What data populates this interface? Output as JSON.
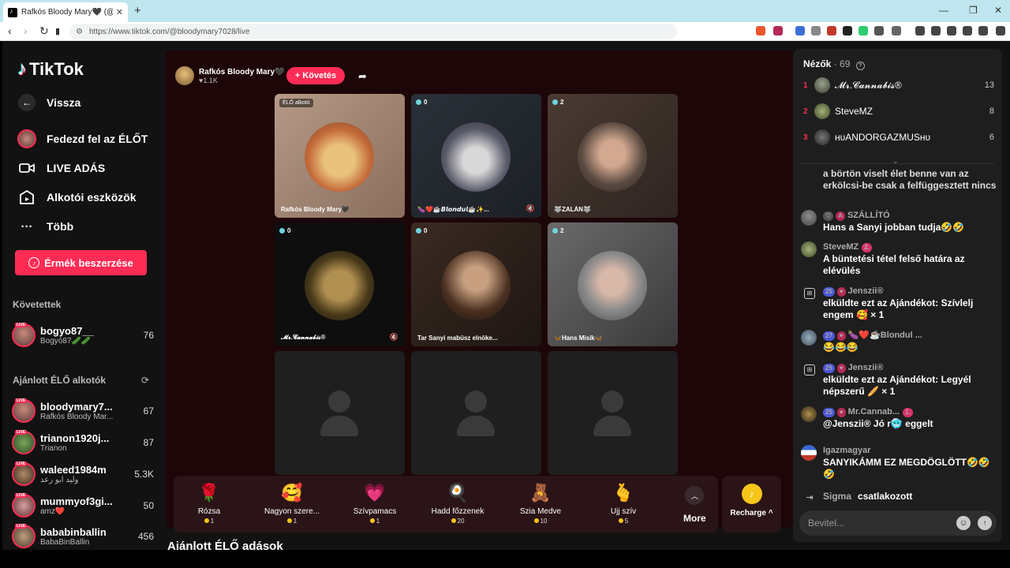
{
  "browser": {
    "tab_title": "Rafkós Bloody Mary🖤 (@bl",
    "url": "https://www.tiktok.com/@bloodymary7028/live"
  },
  "sidebar": {
    "logo": "TikTok",
    "nav": [
      {
        "label": "Vissza",
        "icon": "arrow-left-icon"
      },
      {
        "label": "Fedezd fel az ÉLŐT",
        "icon": "avatar-icon"
      },
      {
        "label": "LIVE ADÁS",
        "icon": "video-camera-icon"
      },
      {
        "label": "Alkotói eszközök",
        "icon": "creator-tools-icon"
      },
      {
        "label": "Több",
        "icon": "more-dots-icon"
      }
    ],
    "coins_button": "Érmék beszerzése",
    "following_header": "Követettek",
    "following": [
      {
        "name": "bogyo87__",
        "sub": "Bogyó87🥒🥒",
        "count": "76"
      }
    ],
    "recommended_header": "Ajánlott ÉLŐ alkotók",
    "recommended": [
      {
        "name": "bloodymary7...",
        "sub": "Rafkós Bloody Mar...",
        "count": "67"
      },
      {
        "name": "trianon1920j...",
        "sub": "Trianon",
        "count": "87"
      },
      {
        "name": "waleed1984m",
        "sub": "وليد ابو رعد",
        "count": "5.3K"
      },
      {
        "name": "mummyof3gi...",
        "sub": "amz❤️",
        "count": "50"
      },
      {
        "name": "bababinballin",
        "sub": "BabaBinBallin",
        "count": "456"
      }
    ]
  },
  "stream": {
    "host_name": "Rafkós Bloody Mary🖤",
    "host_likes": "♥1.1K",
    "follow_label": "+ Követés",
    "cells": [
      {
        "name": "Rafkós Bloody Mary🖤",
        "badge": "ÉLŐ alkotó",
        "type": "host"
      },
      {
        "name": "🍆❤️☕𝘽𝙡𝙤𝙣𝙙𝙪𝙡☕✨...",
        "badge": "0",
        "type": "guest"
      },
      {
        "name": "🐺ZALÁN🐺",
        "badge": "2",
        "type": "guest"
      },
      {
        "name": "𝓜𝓻.𝓒𝓪𝓷𝓷𝓪𝓫𝓲𝓼®",
        "badge": "0",
        "type": "guest"
      },
      {
        "name": "Tar Sanyi mabüsz elnöke...",
        "badge": "0",
        "type": "guest"
      },
      {
        "name": "🦋Hans Misik🦋",
        "badge": "2",
        "type": "guest"
      }
    ],
    "gifts": [
      {
        "name": "Rózsa",
        "price": "1",
        "icon": "rose-icon"
      },
      {
        "name": "Nagyon szere...",
        "price": "1",
        "icon": "heart-face-icon"
      },
      {
        "name": "Szívpamacs",
        "price": "1",
        "icon": "heart-puff-icon"
      },
      {
        "name": "Hadd főzzenek",
        "price": "20",
        "icon": "cook-icon"
      },
      {
        "name": "Szia Medve",
        "price": "10",
        "icon": "bear-icon"
      },
      {
        "name": "Ujj szív",
        "price": "5",
        "icon": "finger-heart-icon"
      }
    ],
    "more_label": "More",
    "recharge_label": "Recharge ^",
    "recommended_section": "Ajánlott ÉLŐ adások"
  },
  "viewers": {
    "title": "Nézők",
    "count": "· 69",
    "top": [
      {
        "rank": "1",
        "name": "𝓜𝓻.𝓒𝓪𝓷𝓷𝓪𝓫𝓲𝓼®",
        "score": "13"
      },
      {
        "rank": "2",
        "name": "SteveMZ",
        "score": "8"
      },
      {
        "rank": "3",
        "name": "ʜᴜANDORGAZMUSʜᴜ",
        "score": "6"
      }
    ]
  },
  "chat": [
    {
      "type": "text",
      "user": "",
      "text": "a börtön viselt élet benne van az erkölcsi-be csak a felfüggesztett nincs"
    },
    {
      "type": "text",
      "user": "SZÁLLÍTÓ",
      "badges": [
        "♡",
        "A"
      ],
      "text": "Hans a Sanyi jobban tudja🤣🤣"
    },
    {
      "type": "text",
      "user": "SteveMZ",
      "badges": [
        "2."
      ],
      "text": "A büntetési tétel felső határa az elévülés"
    },
    {
      "type": "gift",
      "user": "Jenszii®",
      "badges": [
        "25",
        "♥"
      ],
      "text": "elküldte ezt az Ajándékot: Szívlelj engem 🥰 × 1"
    },
    {
      "type": "text",
      "user": "🍆❤️☕Blondul ...",
      "badges": [
        "27",
        "♥"
      ],
      "text": "😂😂😂"
    },
    {
      "type": "gift",
      "user": "Jenszii®",
      "badges": [
        "25",
        "♥"
      ],
      "text": "elküldte ezt az Ajándékot: Legyél népszerű 🥖 × 1"
    },
    {
      "type": "text",
      "user": "Mr.Cannab...",
      "badges": [
        "25",
        "♥",
        "1."
      ],
      "text": "@Jenszii® Jó r🥶 eggelt"
    },
    {
      "type": "text",
      "user": "Igazmagyar",
      "badges": [],
      "text": "SANYIKÁMM EZ MEGDÖGLÖTT🤣🤣🤣"
    },
    {
      "type": "join",
      "user": "Sigma",
      "badges": [],
      "text": "csatlakozott"
    }
  ],
  "input": {
    "placeholder": "Bevitel..."
  }
}
